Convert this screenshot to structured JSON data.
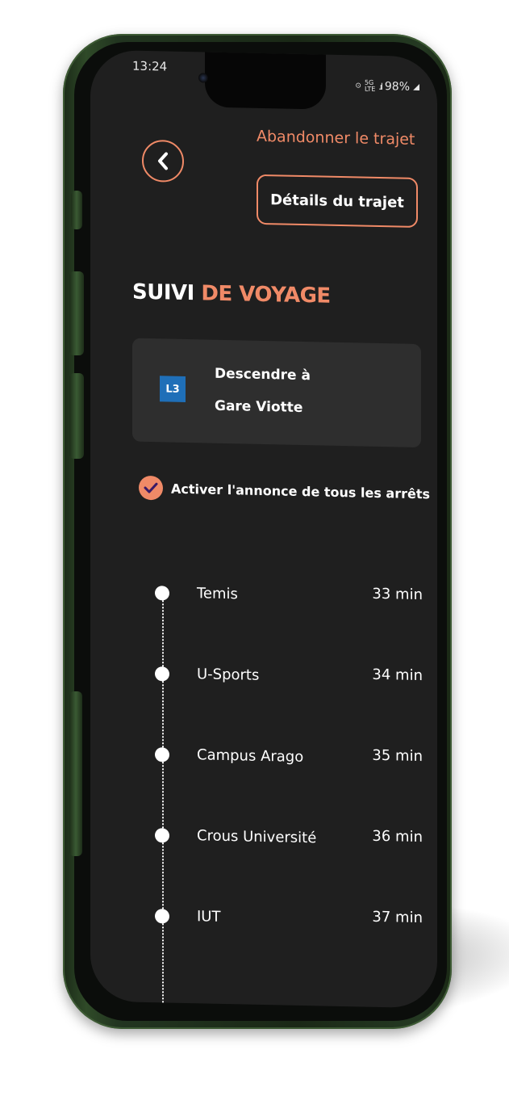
{
  "status_bar": {
    "time": "13:24",
    "network_top": "5G",
    "network_bottom": "LTE",
    "battery": "98%"
  },
  "header": {
    "back_icon": "chevron-left-icon",
    "abandon_label": "Abandonner le trajet",
    "details_label": "Détails du trajet"
  },
  "title": {
    "part1": "SUIVI",
    "part2": "DE VOYAGE"
  },
  "next_stop": {
    "line": "L3",
    "line_color": "#1f6fb8",
    "text_line1": "Descendre à",
    "text_line2": "Gare Viotte"
  },
  "announce": {
    "label": "Activer l'annonce de tous les arrêts",
    "checked": true
  },
  "stops": [
    {
      "name": "Temis",
      "time": "33 min"
    },
    {
      "name": "U-Sports",
      "time": "34 min"
    },
    {
      "name": "Campus Arago",
      "time": "35 min"
    },
    {
      "name": "Crous Université",
      "time": "36 min"
    },
    {
      "name": "IUT",
      "time": "37 min"
    }
  ],
  "colors": {
    "accent": "#f08a67",
    "background": "#1f1f1f",
    "card": "#2e2e2e"
  }
}
